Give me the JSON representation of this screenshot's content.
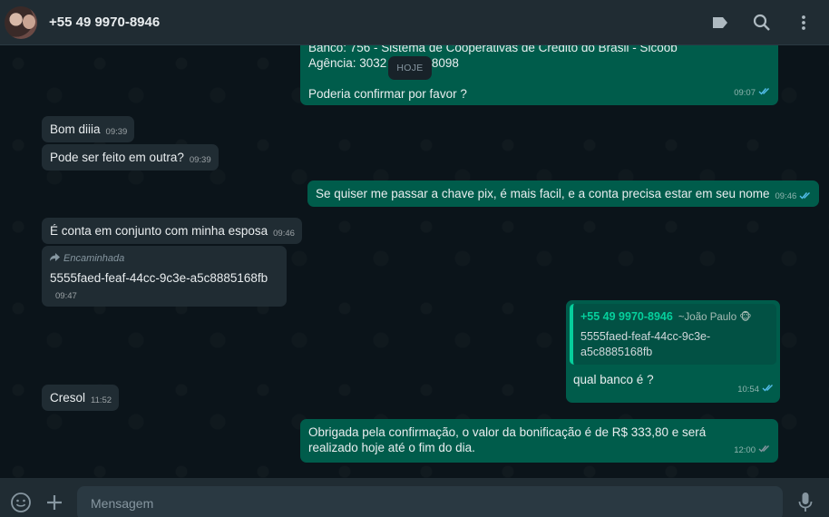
{
  "header": {
    "contact_name": "+55 49 9970-8946",
    "icons": [
      "label-icon",
      "search-icon",
      "menu-icon"
    ]
  },
  "chat": {
    "date_chip": "HOJE",
    "messages": [
      {
        "direction": "out",
        "lines": [
          "Banco: 756 - Sistema de Cooperativas de Credito do Brasil - Sicoob",
          "Agência: 3032 C/C: 208098",
          "Poderia confirmar por favor ?"
        ],
        "time": "09:07",
        "status": "read"
      },
      {
        "direction": "in",
        "text": "Bom diiia",
        "time": "09:39"
      },
      {
        "direction": "in",
        "text": "Pode ser feito em outra?",
        "time": "09:39"
      },
      {
        "direction": "out",
        "text": "Se quiser me passar a chave pix, é mais facil, e a conta precisa estar em seu nome",
        "time": "09:46",
        "status": "read"
      },
      {
        "direction": "in",
        "text": "É conta em conjunto com minha esposa",
        "time": "09:46"
      },
      {
        "direction": "in",
        "forwarded_label": "Encaminhada",
        "text": "5555faed-feaf-44cc-9c3e-a5c8885168fb",
        "time": "09:47"
      },
      {
        "direction": "out",
        "quote": {
          "sender": "+55 49 9970-8946",
          "alias": "~João Paulo 🐵",
          "text": "5555faed-feaf-44cc-9c3e-a5c8885168fb"
        },
        "text": "qual banco é ?",
        "time": "10:54",
        "status": "read"
      },
      {
        "direction": "in",
        "text": "Cresol",
        "time": "11:52"
      },
      {
        "direction": "out",
        "text": "Obrigada pela confirmação, o valor da bonificação é de R$ 333,80 e será realizado hoje até o fim do dia.",
        "time": "12:00",
        "status": "delivered"
      }
    ]
  },
  "composer": {
    "placeholder": "Mensagem",
    "icons": [
      "emoji-icon",
      "attach-plus-icon",
      "microphone-icon"
    ]
  },
  "colors": {
    "header_bg": "#202c33",
    "chat_bg": "#0b141a",
    "incoming_bubble": "#202c33",
    "outgoing_bubble": "#005c4b",
    "read_tick": "#53bdeb",
    "quote_accent": "#06cf9c"
  }
}
